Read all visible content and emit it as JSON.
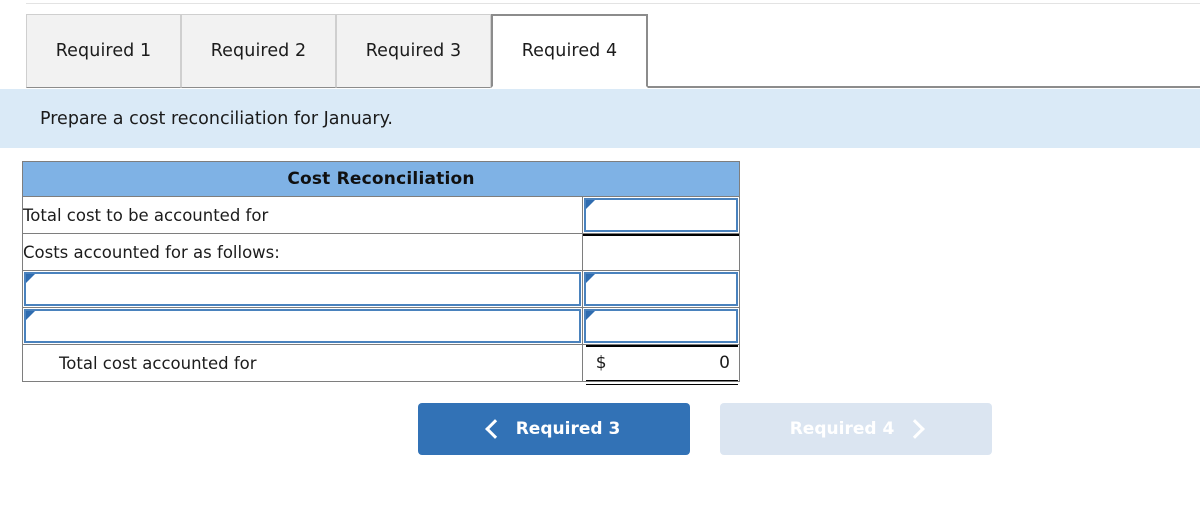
{
  "tabs": {
    "items": [
      {
        "label": "Required 1",
        "active": false
      },
      {
        "label": "Required 2",
        "active": false
      },
      {
        "label": "Required 3",
        "active": false
      },
      {
        "label": "Required 4",
        "active": true
      }
    ]
  },
  "instruction": {
    "text": "Prepare a cost reconciliation for January."
  },
  "table": {
    "title": "Cost Reconciliation",
    "rows": [
      {
        "label": "Total cost to be accounted for",
        "label_editable": false,
        "value": "",
        "value_editable": true,
        "indent": false,
        "underline": true
      },
      {
        "label": "Costs accounted for as follows:",
        "label_editable": false,
        "value": "",
        "value_editable": false,
        "indent": false,
        "underline": false
      },
      {
        "label": "",
        "label_editable": true,
        "value": "",
        "value_editable": true,
        "indent": false,
        "underline": false
      },
      {
        "label": "",
        "label_editable": true,
        "value": "",
        "value_editable": true,
        "indent": false,
        "underline": false
      }
    ],
    "total_row": {
      "label": "Total cost accounted for",
      "currency": "$",
      "amount": "0"
    }
  },
  "nav": {
    "prev": {
      "label": "Required 3",
      "icon": "chevron-left-icon",
      "enabled": true
    },
    "next": {
      "label": "Required 4",
      "icon": "chevron-right-icon",
      "enabled": false
    }
  },
  "colors": {
    "table_header": "#7fb2e5",
    "instruction_bg": "#daeaf7",
    "field_border": "#4a82bd",
    "marker": "#2f6cb0",
    "prev_button": "#3272b6",
    "next_button": "#dbe5f1"
  }
}
